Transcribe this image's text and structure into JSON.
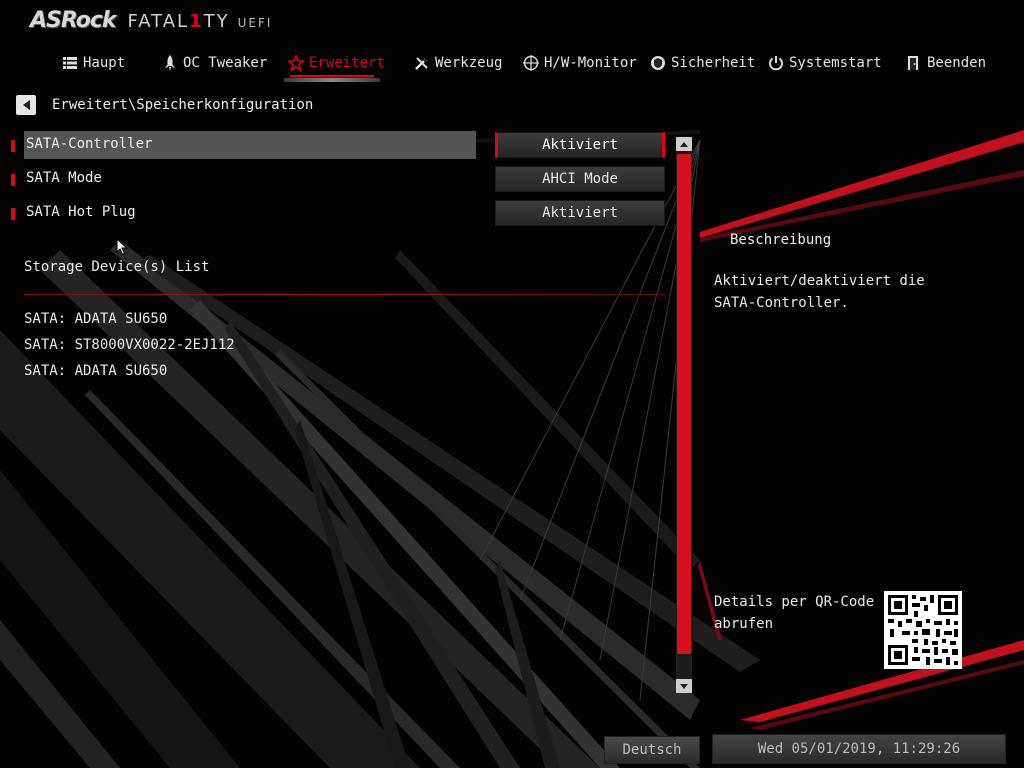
{
  "logo": {
    "brand": "ASRock",
    "product_prefix": "FATAL",
    "product_one": "1",
    "product_suffix": "TY",
    "uefi": "UEFI"
  },
  "nav": [
    {
      "label": "Haupt",
      "icon": "list-icon",
      "active": false
    },
    {
      "label": "OC Tweaker",
      "icon": "rocket-icon",
      "active": false
    },
    {
      "label": "Erweitert",
      "icon": "star-icon",
      "active": true
    },
    {
      "label": "Werkzeug",
      "icon": "tools-icon",
      "active": false
    },
    {
      "label": "H/W-Monitor",
      "icon": "crosshair-icon",
      "active": false
    },
    {
      "label": "Sicherheit",
      "icon": "shield-icon",
      "active": false
    },
    {
      "label": "Systemstart",
      "icon": "power-icon",
      "active": false
    },
    {
      "label": "Beenden",
      "icon": "exit-door-icon",
      "active": false
    }
  ],
  "breadcrumb": "Erweitert\\Speicherkonfiguration",
  "settings": [
    {
      "label": "SATA-Controller",
      "value": "Aktiviert",
      "selected": true
    },
    {
      "label": "SATA Mode",
      "value": "AHCI Mode",
      "selected": false
    },
    {
      "label": "SATA Hot Plug",
      "value": "Aktiviert",
      "selected": false
    }
  ],
  "storage": {
    "title": "Storage Device(s) List",
    "devices": [
      "SATA: ADATA SU650",
      "SATA: ST8000VX0022-2EJ112",
      "SATA: ADATA SU650"
    ]
  },
  "description": {
    "heading": "Beschreibung",
    "text": "Aktiviert/deaktiviert die SATA-Controller.",
    "qr_label": "Details per QR-Code abrufen"
  },
  "footer": {
    "language": "Deutsch",
    "datetime": "Wed 05/01/2019, 11:29:26"
  },
  "colors": {
    "accent": "#e2001a",
    "background": "#000000",
    "text": "#e8e8e8"
  }
}
